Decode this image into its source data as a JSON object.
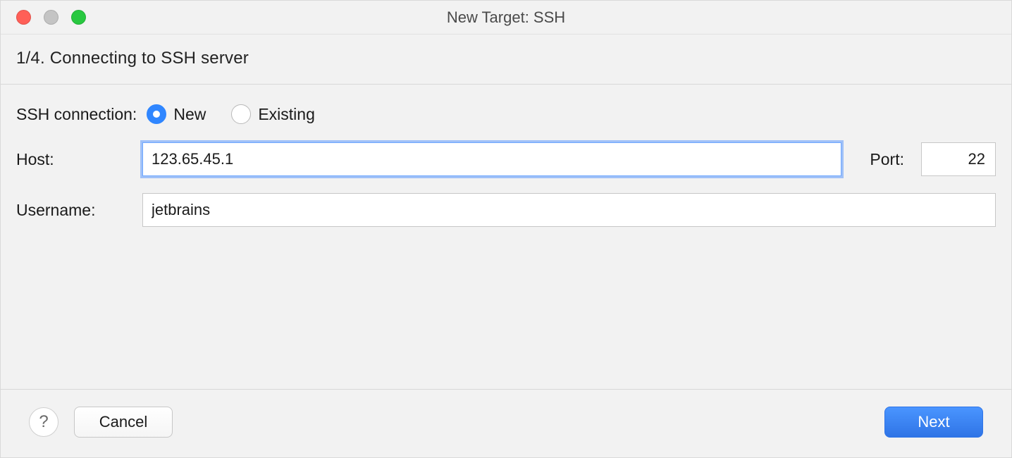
{
  "window": {
    "title": "New Target: SSH"
  },
  "step": {
    "heading": "1/4. Connecting to SSH server"
  },
  "connection": {
    "label": "SSH connection:",
    "options": {
      "new": "New",
      "existing": "Existing"
    },
    "selected": "new"
  },
  "form": {
    "host_label": "Host:",
    "host_value": "123.65.45.1",
    "port_label": "Port:",
    "port_value": "22",
    "username_label": "Username:",
    "username_value": "jetbrains"
  },
  "footer": {
    "help_tooltip": "?",
    "cancel": "Cancel",
    "next": "Next"
  }
}
